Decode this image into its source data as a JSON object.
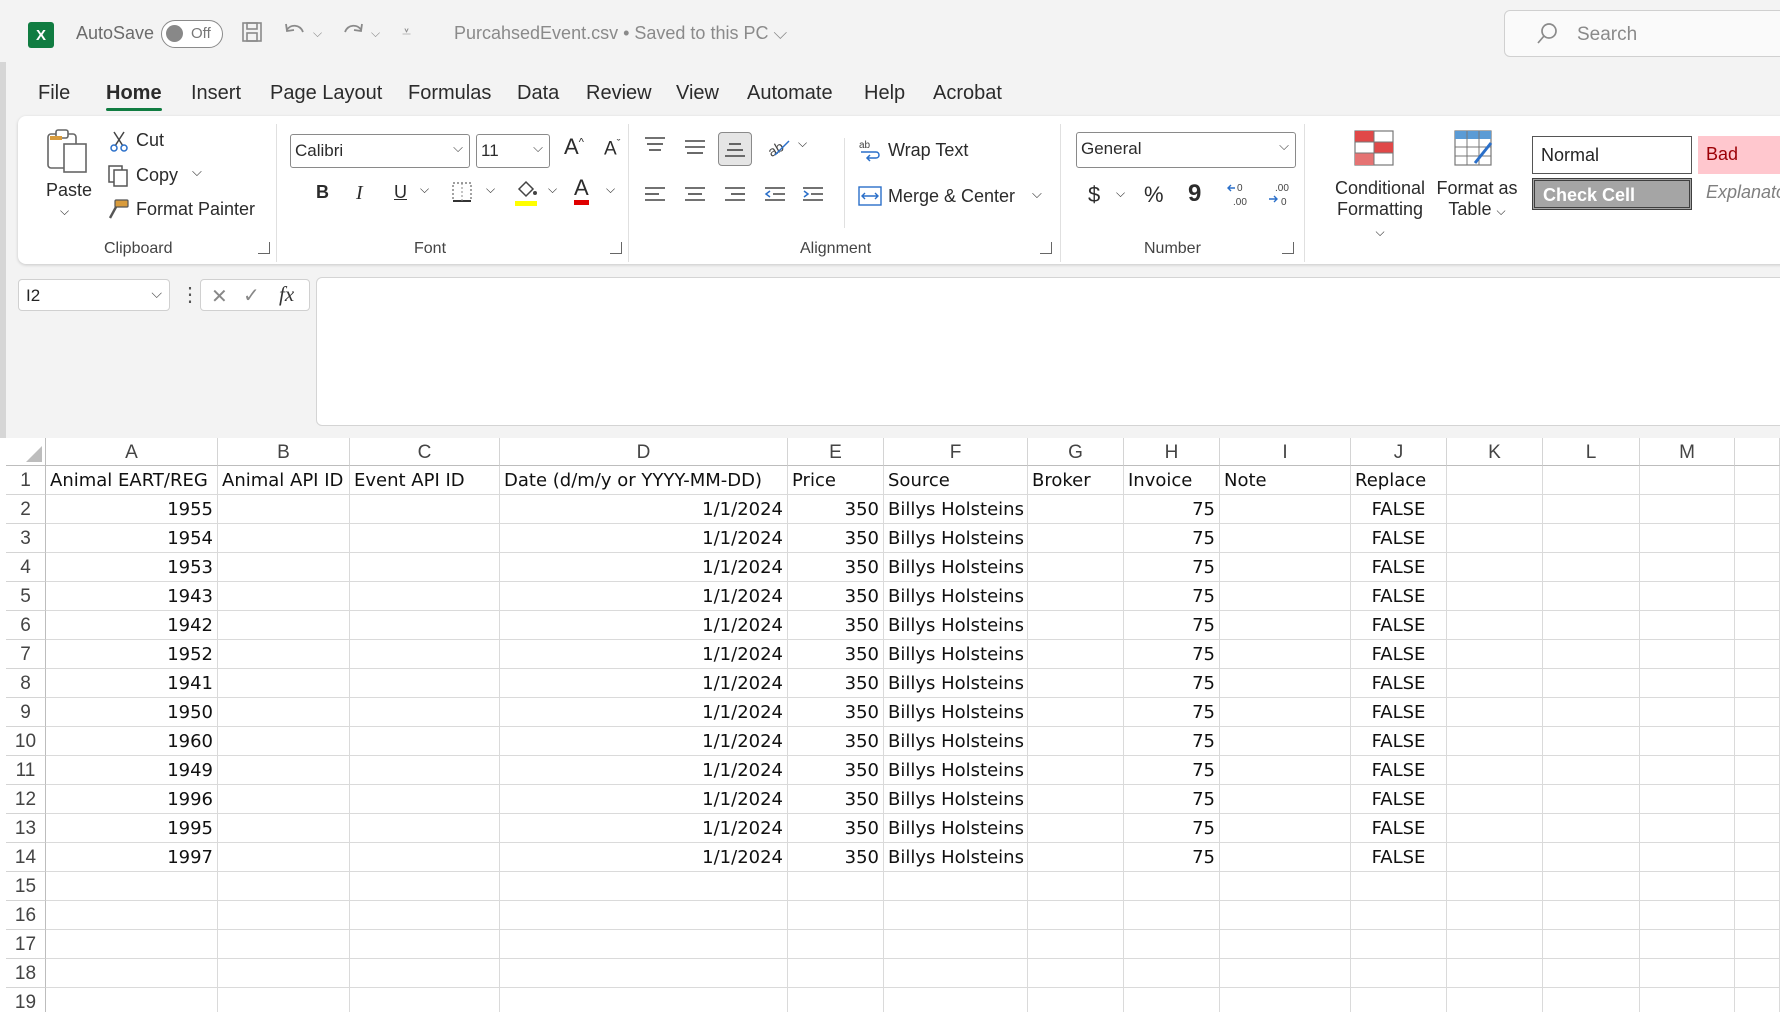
{
  "titlebar": {
    "app_icon": "X",
    "autosave_label": "AutoSave",
    "autosave_state": "Off",
    "doc_title": "PurcahsedEvent.csv • Saved to this PC",
    "search_placeholder": "Search"
  },
  "tabs": [
    "File",
    "Home",
    "Insert",
    "Page Layout",
    "Formulas",
    "Data",
    "Review",
    "View",
    "Automate",
    "Help",
    "Acrobat"
  ],
  "ribbon": {
    "clipboard": {
      "paste": "Paste",
      "cut": "Cut",
      "copy": "Copy",
      "format_painter": "Format Painter",
      "label": "Clipboard"
    },
    "font": {
      "family": "Calibri",
      "size": "11",
      "bold": "B",
      "italic": "I",
      "underline": "U",
      "font_color_glyph": "A",
      "label": "Font"
    },
    "alignment": {
      "wrap_text": "Wrap Text",
      "merge_center": "Merge & Center",
      "label": "Alignment"
    },
    "number": {
      "format": "General",
      "currency": "$",
      "percent": "%",
      "comma": "9",
      "label": "Number"
    },
    "styles": {
      "conditional_formatting_line1": "Conditional",
      "conditional_formatting_line2": "Formatting",
      "format_table_line1": "Format as",
      "format_table_line2": "Table",
      "normal": "Normal",
      "bad": "Bad",
      "check_cell": "Check Cell",
      "explanatory": "Explanato"
    }
  },
  "formula_bar": {
    "name_box": "I2",
    "fx": "fx",
    "value": ""
  },
  "sheet": {
    "columns": [
      "A",
      "B",
      "C",
      "D",
      "E",
      "F",
      "G",
      "H",
      "I",
      "J",
      "K",
      "L",
      "M",
      ""
    ],
    "row_numbers": [
      "1",
      "2",
      "3",
      "4",
      "5",
      "6",
      "7",
      "8",
      "9",
      "10",
      "11",
      "12",
      "13",
      "14",
      "15",
      "16",
      "17",
      "18",
      "19"
    ],
    "header_row": [
      "Animal EART/REG",
      "Animal API ID",
      "Event API ID",
      "Date (d/m/y or YYYY-MM-DD)",
      "Price",
      "Source",
      "Broker",
      "Invoice",
      "Note",
      "Replace"
    ],
    "rows": [
      [
        "1955",
        "",
        "",
        "1/1/2024",
        "350",
        "Billys Holsteins",
        "",
        "75",
        "",
        "FALSE"
      ],
      [
        "1954",
        "",
        "",
        "1/1/2024",
        "350",
        "Billys Holsteins",
        "",
        "75",
        "",
        "FALSE"
      ],
      [
        "1953",
        "",
        "",
        "1/1/2024",
        "350",
        "Billys Holsteins",
        "",
        "75",
        "",
        "FALSE"
      ],
      [
        "1943",
        "",
        "",
        "1/1/2024",
        "350",
        "Billys Holsteins",
        "",
        "75",
        "",
        "FALSE"
      ],
      [
        "1942",
        "",
        "",
        "1/1/2024",
        "350",
        "Billys Holsteins",
        "",
        "75",
        "",
        "FALSE"
      ],
      [
        "1952",
        "",
        "",
        "1/1/2024",
        "350",
        "Billys Holsteins",
        "",
        "75",
        "",
        "FALSE"
      ],
      [
        "1941",
        "",
        "",
        "1/1/2024",
        "350",
        "Billys Holsteins",
        "",
        "75",
        "",
        "FALSE"
      ],
      [
        "1950",
        "",
        "",
        "1/1/2024",
        "350",
        "Billys Holsteins",
        "",
        "75",
        "",
        "FALSE"
      ],
      [
        "1960",
        "",
        "",
        "1/1/2024",
        "350",
        "Billys Holsteins",
        "",
        "75",
        "",
        "FALSE"
      ],
      [
        "1949",
        "",
        "",
        "1/1/2024",
        "350",
        "Billys Holsteins",
        "",
        "75",
        "",
        "FALSE"
      ],
      [
        "1996",
        "",
        "",
        "1/1/2024",
        "350",
        "Billys Holsteins",
        "",
        "75",
        "",
        "FALSE"
      ],
      [
        "1995",
        "",
        "",
        "1/1/2024",
        "350",
        "Billys Holsteins",
        "",
        "75",
        "",
        "FALSE"
      ],
      [
        "1997",
        "",
        "",
        "1/1/2024",
        "350",
        "Billys Holsteins",
        "",
        "75",
        "",
        "FALSE"
      ]
    ],
    "selected_cell": "I2"
  },
  "colors": {
    "excel_green": "#107c41",
    "bad_fill": "#ffc7ce",
    "bad_text": "#9c0006",
    "check_fill": "#a5a5a5"
  }
}
